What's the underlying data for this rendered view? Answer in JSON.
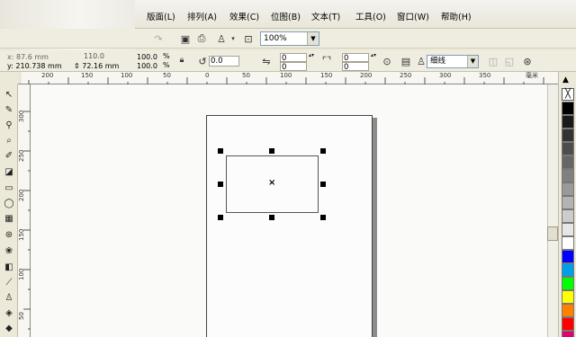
{
  "menu": {
    "items": [
      "版面(L)",
      "排列(A)",
      "效果(C)",
      "位图(B)",
      "文本(T)",
      "工具(O)",
      "窗口(W)",
      "帮助(H)"
    ]
  },
  "toolbar": {
    "zoom": "100%"
  },
  "propbar": {
    "x_label": "y:",
    "y_value": "210.738 mm",
    "height_value": "72.16 mm",
    "width_top_value": "110.0",
    "scale_w": "100.0",
    "scale_h": "100.0",
    "percent": "%",
    "rotation": "0.0",
    "corner_a": "0",
    "corner_b": "0",
    "corner_c": "0",
    "corner_d": "0",
    "outline": "细线"
  },
  "ruler": {
    "top_ticks": [
      "200",
      "150",
      "100",
      "50",
      "0",
      "50",
      "100",
      "150",
      "200",
      "250",
      "300",
      "350"
    ],
    "left_ticks": [
      "300",
      "250",
      "200",
      "150",
      "100",
      "50"
    ],
    "unit": "毫米"
  },
  "palette": {
    "colors": [
      "#ffffff",
      "#000000",
      "#1a1a1a",
      "#333333",
      "#4d4d4d",
      "#666666",
      "#808080",
      "#999999",
      "#b3b3b3",
      "#cccccc",
      "#e6e6e6",
      "#ffffff",
      "#0000ff",
      "#00a0e9",
      "#00ff00",
      "#ffff00",
      "#ff8000",
      "#ff0000",
      "#e0006f"
    ]
  }
}
